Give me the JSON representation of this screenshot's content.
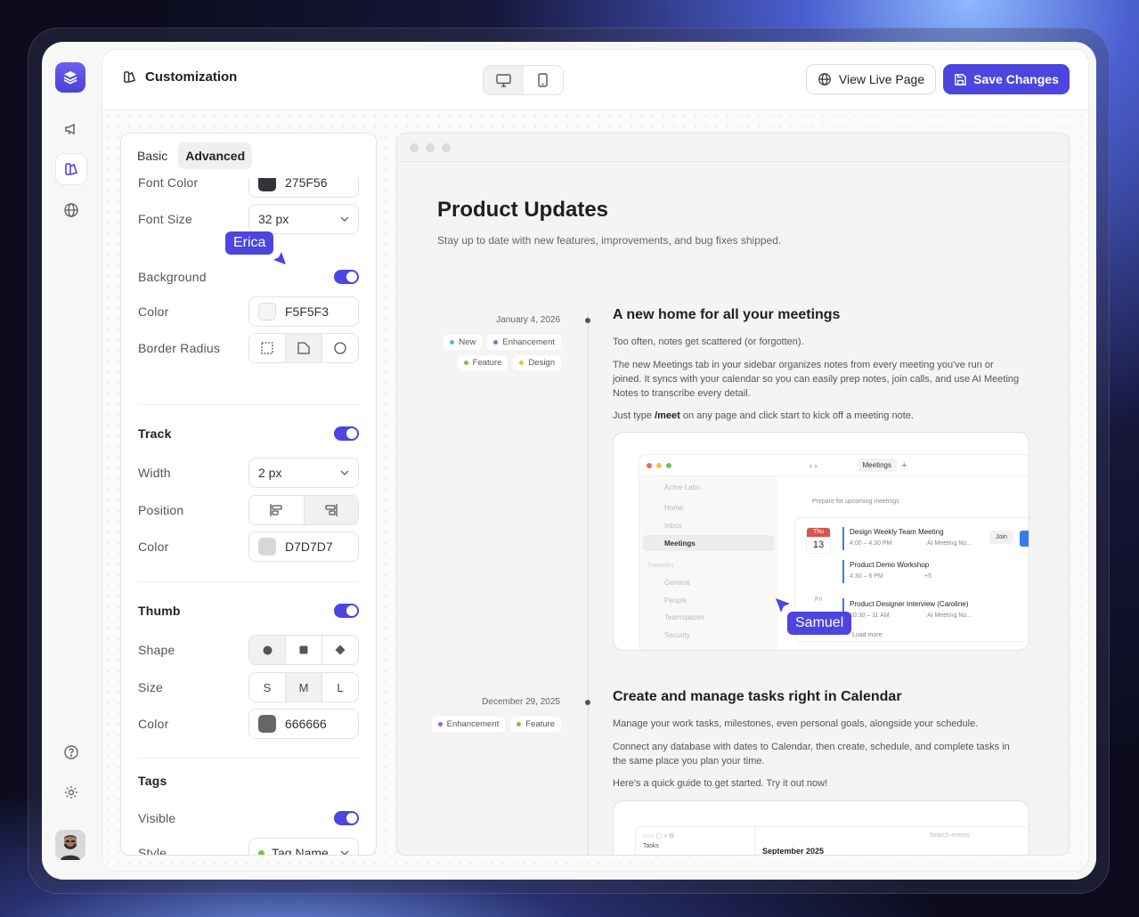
{
  "topbar": {
    "title": "Customization",
    "view_live_label": "View Live Page",
    "save_label": "Save Changes"
  },
  "panel": {
    "tabs": [
      "Basic",
      "Advanced"
    ],
    "font_color": {
      "label": "Font Color",
      "value": "275F56"
    },
    "font_size": {
      "label": "Font Size",
      "value": "32 px"
    },
    "background": {
      "label": "Background"
    },
    "bg_color": {
      "label": "Color",
      "value": "F5F5F3"
    },
    "border_radius": {
      "label": "Border Radius"
    },
    "track": {
      "heading": "Track",
      "width_label": "Width",
      "width_value": "2 px",
      "position_label": "Position",
      "color_label": "Color",
      "color_value": "D7D7D7"
    },
    "thumb": {
      "heading": "Thumb",
      "shape_label": "Shape",
      "size_label": "Size",
      "sizes": [
        "S",
        "M",
        "L"
      ],
      "color_label": "Color",
      "color_value": "666666"
    },
    "tags": {
      "heading": "Tags",
      "visible_label": "Visible",
      "style_label": "Style",
      "style_value": "Tag Name"
    }
  },
  "cursors": {
    "erica": "Erica",
    "samuel": "Samuel"
  },
  "preview": {
    "title": "Product Updates",
    "subtitle": "Stay up to date with new features, improvements, and bug fixes shipped.",
    "entries": [
      {
        "date": "January 4, 2026",
        "tags": [
          {
            "label": "New",
            "color": "#5ab7e6"
          },
          {
            "label": "Enhancement",
            "color": "#9a5be8"
          },
          {
            "label": "Feature",
            "color": "#7cc241"
          },
          {
            "label": "Design",
            "color": "#e8c33a"
          }
        ],
        "title": "A new home for all your meetings",
        "p1": "Too often, notes get scattered (or forgotten).",
        "p2": "The new Meetings tab in your sidebar organizes notes from every meeting you've run or joined. It syncs with your calendar so you can easily prep notes, join calls, and use AI Meeting Notes to transcribe every detail.",
        "p3_pre": "Just type ",
        "p3_bold": "/meet",
        "p3_post": " on any page and click start to kick off a meeting note."
      },
      {
        "date": "December 29, 2025",
        "tags": [
          {
            "label": "Enhancement",
            "color": "#9a5be8"
          },
          {
            "label": "Feature",
            "color": "#7cc241"
          }
        ],
        "title": "Create and manage tasks right in Calendar",
        "p1": "Manage your work tasks, milestones, even personal goals, alongside your schedule.",
        "p2": "Connect any database with dates to Calendar, then create, schedule, and complete tasks in the same place you plan your time.",
        "p3": "Here's a quick guide to get started. Try it out now!"
      }
    ],
    "meetings_shot": {
      "tab": "Meetings",
      "workspace": "Acme Labs",
      "nav": [
        "Home",
        "Inbox",
        "Meetings"
      ],
      "favorites_label": "Favorites",
      "nav2": [
        "General",
        "People",
        "Teamspaces",
        "Security"
      ],
      "prep": "Prepare for upcoming meetings",
      "day1": {
        "dow": "Thu",
        "num": "13"
      },
      "day2": {
        "dow": "Fri"
      },
      "meetings": [
        {
          "title": "Design Weekly Team Meeting",
          "time": "4:00 – 4:30 PM",
          "note": "AI Meeting No..."
        },
        {
          "title": "Product Demo Workshop",
          "time": "4:30 – 6 PM",
          "extra": "+5"
        },
        {
          "title": "Product Designer Interview (Caroline)",
          "time": "10:30 – 11 AM",
          "note": "AI Meeting No..."
        }
      ],
      "join": "Join",
      "load_more": "Load more"
    },
    "calendar_shot": {
      "tasks": "Tasks",
      "search": "Search events",
      "month": "September 2025"
    }
  }
}
